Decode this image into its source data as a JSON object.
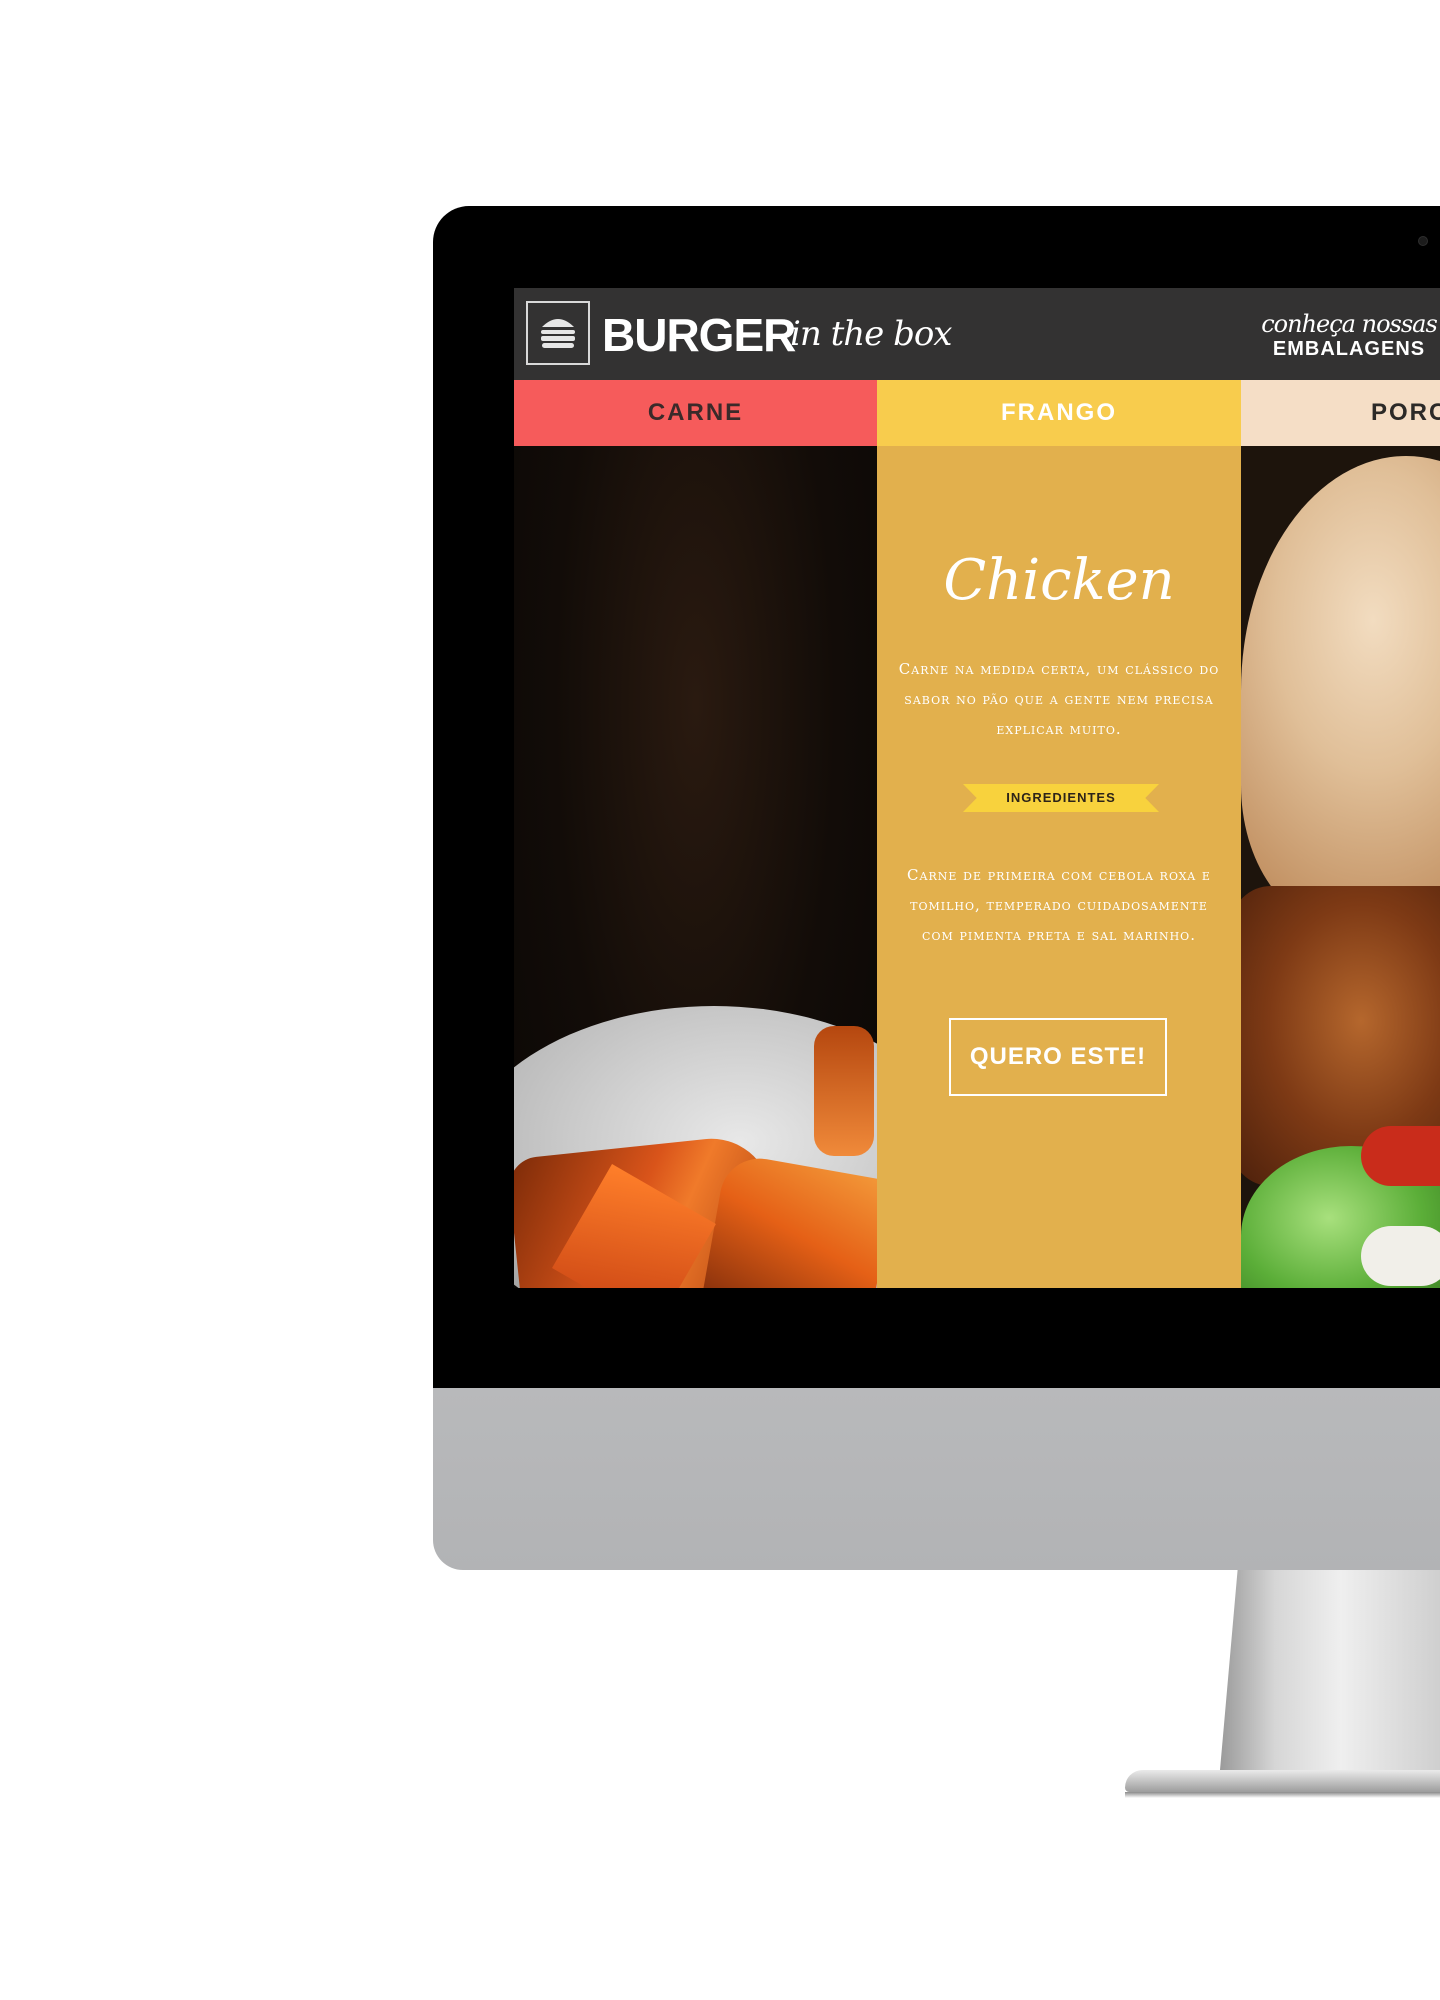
{
  "site": {
    "logo": {
      "brand": "BURGER",
      "tagline": "in the box",
      "icon": "burger-icon"
    },
    "header_link": {
      "script": "conheça nossas",
      "caps": "EMBALAGENS"
    },
    "tabs": [
      {
        "label": "CARNE",
        "color": "#f65b5b"
      },
      {
        "label": "FRANGO",
        "color": "#f8cc4d"
      },
      {
        "label": "PORC",
        "color": "#f5dec6"
      }
    ],
    "product": {
      "title": "Chicken",
      "description": "Carne na medida certa, um clássico do sabor no pão que a gente nem precisa explicar muito.",
      "ingredients_label": "INGREDIENTES",
      "ingredients": "Carne de primeira com cebola roxa e tomilho, temperado cuidadosamente com pimenta preta e sal marinho.",
      "cta": "QUERO ESTE!"
    },
    "colors": {
      "header_bg": "#333232",
      "panel_bg": "#e2b04d",
      "ribbon": "#f8d23d"
    }
  }
}
